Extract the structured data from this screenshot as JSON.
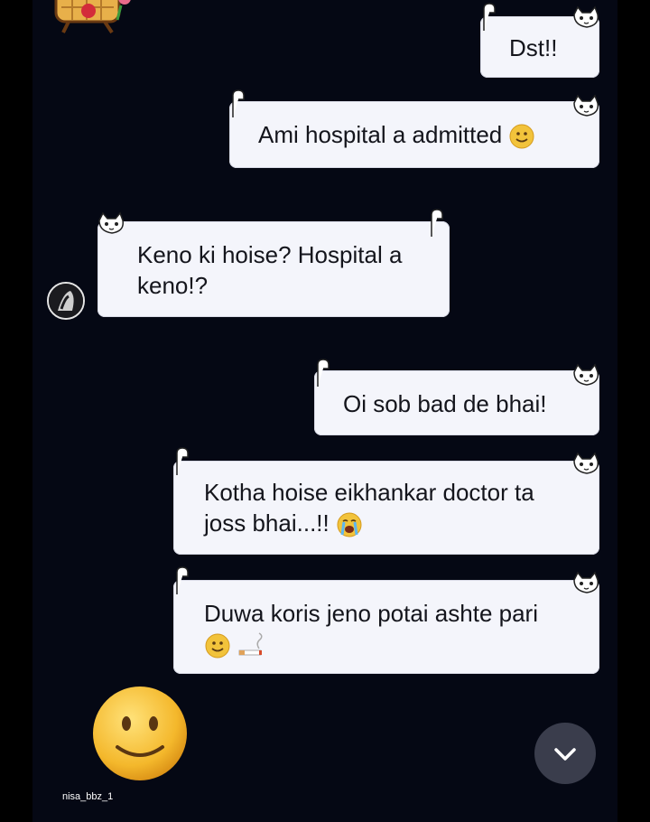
{
  "chat": {
    "messages": [
      {
        "side": "sent",
        "text": "Dst!!",
        "emoji": []
      },
      {
        "side": "sent",
        "text": "Ami hospital a admitted",
        "emoji": [
          "slightly-smiling-face"
        ]
      },
      {
        "side": "received",
        "line1": "Keno ki hoise? Hospital a",
        "line2": "keno!?",
        "emoji": []
      },
      {
        "side": "sent",
        "text": "Oi sob bad de bhai!",
        "emoji": []
      },
      {
        "side": "sent",
        "line1": "Kotha hoise eikhankar doctor ta",
        "line2": "joss bhai...!!",
        "emoji": [
          "loudly-crying-face"
        ]
      },
      {
        "side": "sent",
        "line1": "Duwa koris jeno potai ashte pari",
        "line2": "",
        "emoji": [
          "slightly-smiling-face",
          "cigarette"
        ]
      }
    ],
    "big_emoji": "slightly-smiling-face",
    "watermark": "nisa_bbz_1"
  },
  "colors": {
    "background": "#050814",
    "bubble": "#f4f5fb",
    "text": "#14151c",
    "scroll_button": "#3a3d4c"
  },
  "icons": {
    "scroll_down": "chevron-down-icon",
    "bubble_decoration": "cat-sticker-icon"
  }
}
